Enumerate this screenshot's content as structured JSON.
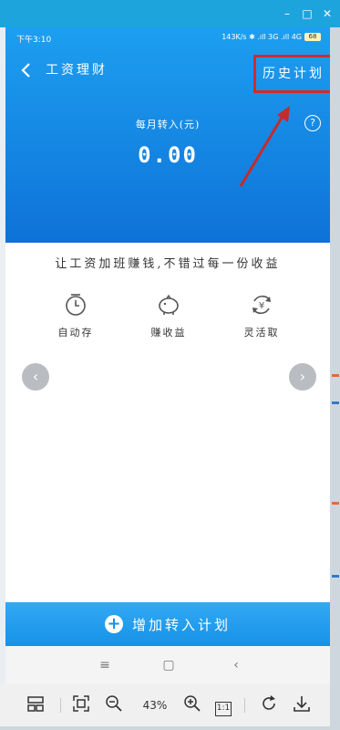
{
  "window": {
    "minimize": "–",
    "maximize": "□",
    "close": "✕"
  },
  "statusbar": {
    "time": "下午3:10",
    "network": "143K/s  ✱  .ıll 3G .ıll 4G",
    "battery": "68"
  },
  "header": {
    "back_icon": "back-arrow-icon",
    "title": "工资理财",
    "history": "历史计划"
  },
  "summary": {
    "monthly_label": "每月转入(元)",
    "help": "?",
    "amount": "0.00"
  },
  "slogan": "让工资加班赚钱,不错过每一份收益",
  "features": [
    {
      "label": "自动存",
      "icon": "clock-icon"
    },
    {
      "label": "赚收益",
      "icon": "piggy-bank-icon"
    },
    {
      "label": "灵活取",
      "icon": "yuan-cycle-icon"
    }
  ],
  "carousel": {
    "prev": "‹",
    "next": "›"
  },
  "add_plan": {
    "icon": "+",
    "label": "增加转入计划"
  },
  "system_nav": {
    "menu": "≡",
    "home": "▢",
    "back": "‹"
  },
  "viewer_toolbar": {
    "zoom_level": "43%",
    "fit_label": "1:1"
  },
  "colors": {
    "accent": "#1592e8",
    "highlight": "#d22b2b"
  }
}
